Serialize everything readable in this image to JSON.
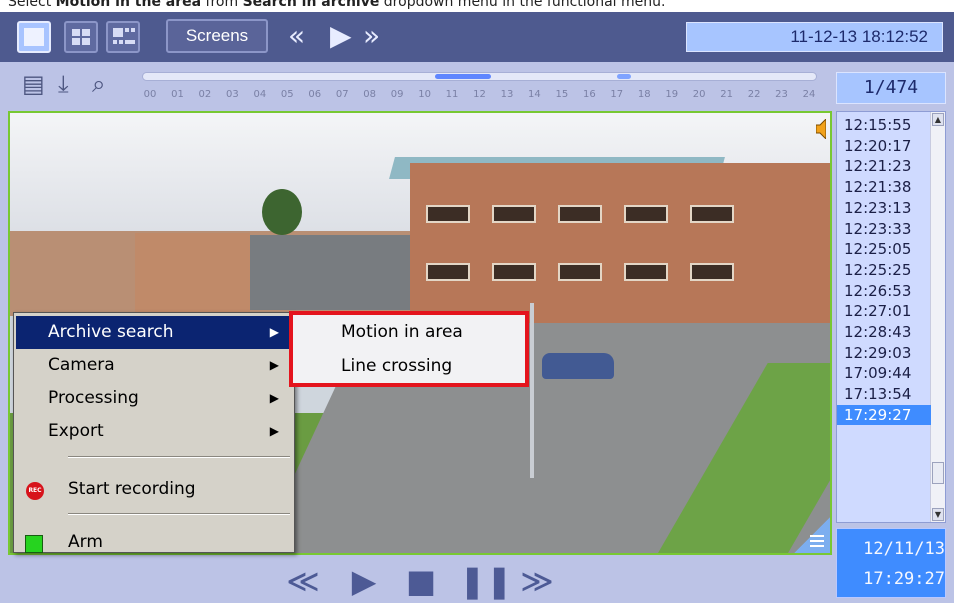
{
  "caption": {
    "text_before": "Select ",
    "text_bold_1": "Motion in the area",
    "text_middle": " from ",
    "text_bold_2": "Search in archive",
    "text_after": " dropdown menu in the functional menu."
  },
  "toolbar": {
    "screens_label": "Screens",
    "clock": "11-12-13  18:12:52"
  },
  "timeline": {
    "hours": [
      "00",
      "01",
      "02",
      "03",
      "04",
      "05",
      "06",
      "07",
      "08",
      "09",
      "10",
      "11",
      "12",
      "13",
      "14",
      "15",
      "16",
      "17",
      "18",
      "19",
      "20",
      "21",
      "22",
      "23",
      "24"
    ],
    "counter": "1/474"
  },
  "timestamps": [
    "12:15:55",
    "12:20:17",
    "12:21:23",
    "12:21:38",
    "12:23:13",
    "12:23:33",
    "12:25:05",
    "12:25:25",
    "12:26:53",
    "12:27:01",
    "12:28:43",
    "12:29:03",
    "17:09:44",
    "17:13:54",
    "17:29:27"
  ],
  "selected_timestamp_index": 14,
  "date_box": {
    "date": "12/11/13",
    "time": "17:29:27"
  },
  "context_menu": {
    "items": [
      {
        "label": "Archive search",
        "selected": true
      },
      {
        "label": "Camera"
      },
      {
        "label": "Processing"
      },
      {
        "label": "Export"
      }
    ],
    "start_recording": "Start recording",
    "rec_badge": "REC",
    "arm": "Arm"
  },
  "submenu": {
    "items": [
      "Motion in area",
      "Line crossing"
    ]
  },
  "colors": {
    "toolbar_bg": "#4e5a8f",
    "accent_blue": "#3f8cff",
    "highlight_red": "#e4141d",
    "viewport_border": "#78c832"
  }
}
